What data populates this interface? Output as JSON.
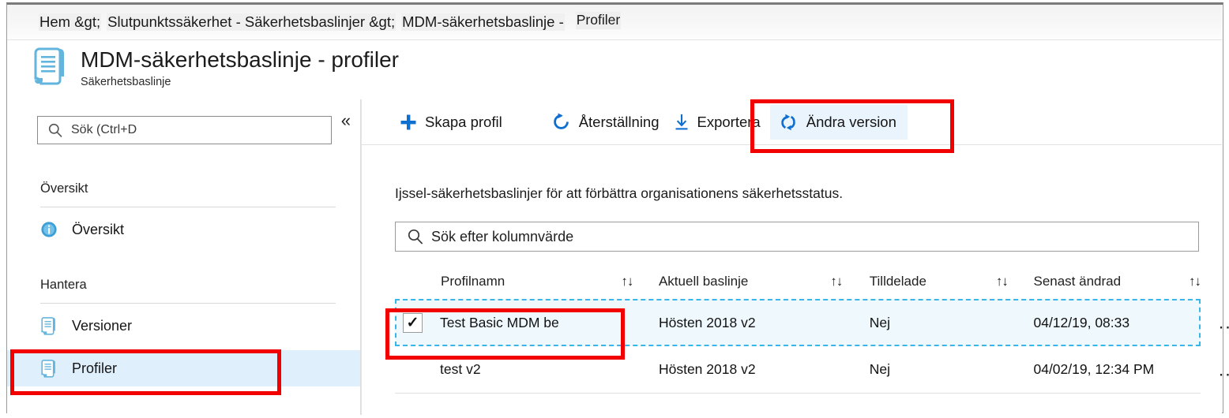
{
  "breadcrumb": {
    "items": [
      "Hem &gt;",
      "Slutpunktssäkerhet - Säkerhetsbaslinjer &gt;",
      "MDM-säkerhetsbaslinje -"
    ],
    "tail": "Profiler"
  },
  "header": {
    "title": "MDM-säkerhetsbaslinje - profiler",
    "subtitle": "Säkerhetsbaslinje",
    "icon": "scroll-document-icon",
    "icon_color": "#64b5dd"
  },
  "sidebar": {
    "search": {
      "placeholder": "Sök (Ctrl+D",
      "value": "",
      "icon": "search-icon"
    },
    "collapse_icon": "«",
    "groups": [
      {
        "label": "Översikt",
        "items": [
          {
            "label": "Översikt",
            "icon": "info-icon",
            "selected": false
          }
        ]
      },
      {
        "label": "Hantera",
        "items": [
          {
            "label": "Versioner",
            "icon": "scroll-document-icon",
            "selected": false
          },
          {
            "label": "Profiler",
            "icon": "scroll-document-icon",
            "selected": true
          }
        ]
      }
    ]
  },
  "toolbar": {
    "buttons": [
      {
        "label": "Skapa profil",
        "icon": "plus-icon",
        "active": false
      },
      {
        "label": "Återställning",
        "icon": "refresh-icon",
        "active": false
      },
      {
        "label": "Exportera",
        "icon": "download-icon",
        "active": false
      },
      {
        "label": "Ändra version",
        "icon": "sync-version-icon",
        "active": true
      }
    ],
    "accent_color": "#0e6fd0"
  },
  "main": {
    "description": "Ijssel-säkerhetsbaslinjer för att förbättra organisationens säkerhetsstatus.",
    "column_search": {
      "placeholder": "Sök efter kolumnvärde",
      "value": "",
      "icon": "search-icon"
    },
    "table": {
      "sort_icon": "↑↓",
      "columns": [
        {
          "label": "Profilnamn",
          "sortable": true
        },
        {
          "label": "Aktuell baslinje",
          "sortable": true
        },
        {
          "label": "Tilldelade",
          "sortable": true
        },
        {
          "label": "Senast ändrad",
          "sortable": true
        }
      ],
      "rows": [
        {
          "checked": true,
          "selected": true,
          "name": "Test Basic MDM be",
          "baseline": "Hösten 2018 v2",
          "assigned": "Nej",
          "modified": "04/12/19, 08:33",
          "more": "..."
        },
        {
          "checked": false,
          "selected": false,
          "name": "test v2",
          "baseline": "Hösten 2018 v2",
          "assigned": "Nej",
          "modified": "04/02/19, 12:34 PM",
          "more": "..."
        }
      ]
    }
  },
  "annotations": {
    "highlight_color": "#f20000",
    "boxes": [
      "change-version-toolbar-button",
      "profiles-sidebar-item",
      "selected-profile-row"
    ]
  }
}
